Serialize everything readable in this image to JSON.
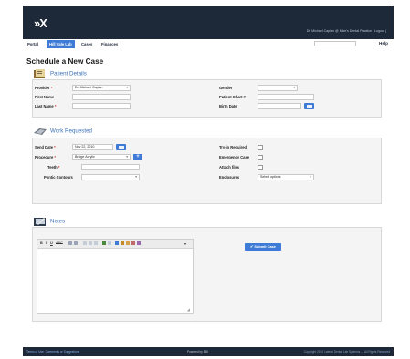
{
  "header": {
    "logo": "»X",
    "user_line": "Dr. Michael Caplan @ Mike's Dental Practice | Logout |"
  },
  "nav": {
    "tabs": [
      {
        "label": "Portal",
        "active": false
      },
      {
        "label": "Hill Vale Lab",
        "active": true
      },
      {
        "label": "Cases",
        "active": false
      },
      {
        "label": "Finances",
        "active": false
      }
    ],
    "search_placeholder": "",
    "help": "Help"
  },
  "page": {
    "title": "Schedule a New Case"
  },
  "patient": {
    "heading": "Patient Details",
    "provider_label": "Provider",
    "provider_value": "Dr. Michael Caplan",
    "first_name_label": "First Name",
    "last_name_label": "Last Name",
    "gender_label": "Gender",
    "chart_label": "Patient Chart #",
    "birth_label": "Birth Date"
  },
  "work": {
    "heading": "Work Requested",
    "send_date_label": "Send Date",
    "send_date_value": "Nov 22, 2010",
    "procedure_label": "Procedure",
    "procedure_value": "Bridge Acrylic",
    "teeth_label": "Teeth",
    "pontic_label": "Pontic Contours",
    "tryin_label": "Try-in Required",
    "emergency_label": "Emergency Case",
    "attach_label": "Attach files",
    "enclosures_label": "Enclosures",
    "enclosures_value": "Select options"
  },
  "notes": {
    "heading": "Notes",
    "toolbar": [
      "B",
      "I",
      "U",
      "ABC"
    ],
    "submit_label": "Submit Case"
  },
  "footer": {
    "left_a": "Terms of Use",
    "left_b": "Comments or Suggestions",
    "center": "Powered by BBI",
    "right": "Copyright 2010 Lateral Dental Lab Systems — All Rights Reserved"
  },
  "colors": {
    "accent": "#3d7bd6",
    "topbar": "#1d2838",
    "section_heading": "#3a6fb6",
    "required": "#d32a2a"
  }
}
